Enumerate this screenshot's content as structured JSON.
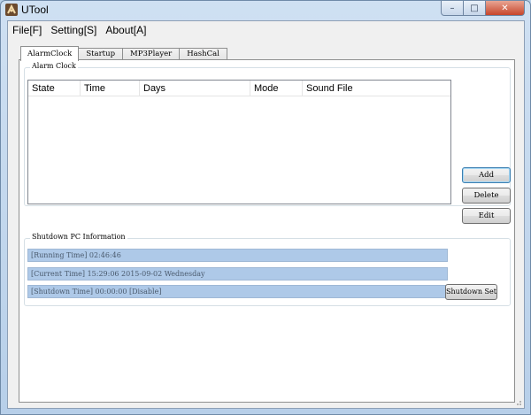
{
  "window": {
    "title": "UTool",
    "controls": {
      "minimize": "–",
      "maximize": "□",
      "close": "✕"
    }
  },
  "menu": {
    "items": [
      {
        "label": "File[F]"
      },
      {
        "label": "Setting[S]"
      },
      {
        "label": "About[A]"
      }
    ]
  },
  "tabs": [
    {
      "label": "AlarmClock",
      "active": true
    },
    {
      "label": "Startup"
    },
    {
      "label": "MP3Player"
    },
    {
      "label": "HashCal"
    }
  ],
  "alarm": {
    "group_title": "Alarm Clock",
    "columns": [
      "State",
      "Time",
      "Days",
      "Mode",
      "Sound File"
    ],
    "rows": [],
    "buttons": {
      "add": "Add",
      "delete": "Delete",
      "edit": "Edit"
    }
  },
  "shutdown": {
    "group_title": "Shutdown PC Information",
    "running_time": "[Running Time] 02:46:46",
    "current_time": "[Current Time] 15:29:06 2015-09-02 Wednesday",
    "shutdown_time": "[Shutdown Time] 00:00:00 [Disable]",
    "button": "Shutdown Set"
  },
  "colors": {
    "info_bar": "#aec9e8",
    "title_bar": "#b9d1ea",
    "close_button": "#c7452b"
  }
}
